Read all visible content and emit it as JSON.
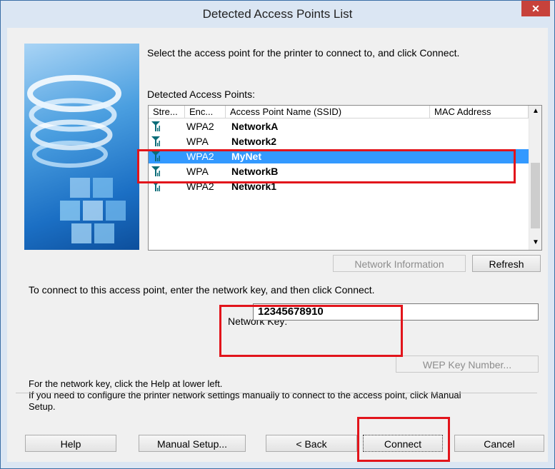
{
  "window": {
    "title": "Detected Access Points List",
    "close_label": "✕"
  },
  "intro_text": "Select the access point for the printer to connect to, and click Connect.",
  "list": {
    "label": "Detected Access Points:",
    "columns": [
      "Stre...",
      "Enc...",
      "Access Point Name (SSID)",
      "MAC Address"
    ],
    "rows": [
      {
        "encryption": "WPA2",
        "ssid": "NetworkA",
        "selected": false
      },
      {
        "encryption": "WPA",
        "ssid": "Network2",
        "selected": false
      },
      {
        "encryption": "WPA2",
        "ssid": "MyNet",
        "selected": true
      },
      {
        "encryption": "WPA",
        "ssid": "NetworkB",
        "selected": false
      },
      {
        "encryption": "WPA2",
        "ssid": "Network1",
        "selected": false
      }
    ],
    "signal_icon": "signal-strength-icon"
  },
  "buttons": {
    "network_info": "Network Information",
    "refresh": "Refresh",
    "wep_key": "WEP Key Number...",
    "help": "Help",
    "manual_setup": "Manual Setup...",
    "back": "< Back",
    "connect": "Connect",
    "cancel": "Cancel"
  },
  "connect_instruction": "To connect to this access point, enter the network key, and then click Connect.",
  "network_key": {
    "label": "Network Key:",
    "value": "12345678910"
  },
  "help_text": {
    "line1": "For the network key, click the Help at lower left.",
    "line2": "If you need to configure the printer network settings manually to connect to the access point, click Manual",
    "line3": "Setup."
  },
  "colors": {
    "selection": "#3399ff",
    "highlight_box": "#e2141b",
    "close_button": "#c7423b",
    "signal_icon": "#0a6c78"
  }
}
